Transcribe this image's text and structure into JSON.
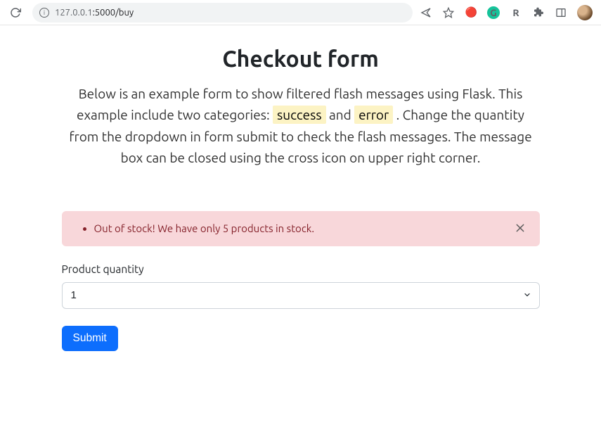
{
  "browser": {
    "url": "127.0.0.1:5000/buy",
    "url_host_prefix": "127.0.0.1",
    "url_path": ":5000/buy"
  },
  "page": {
    "title": "Checkout form",
    "lead_part1": "Below is an example form to show filtered flash messages using Flask. This example include two categories: ",
    "tag_success": "success",
    "lead_part2": " and ",
    "tag_error": "error",
    "lead_part3": " . Change the quantity from the dropdown in form submit to check the flash messages. The message box can be closed using the cross icon on upper right corner."
  },
  "alert": {
    "message": "Out of stock! We have only 5 products in stock."
  },
  "form": {
    "quantity_label": "Product quantity",
    "quantity_value": "1",
    "submit_label": "Submit"
  }
}
